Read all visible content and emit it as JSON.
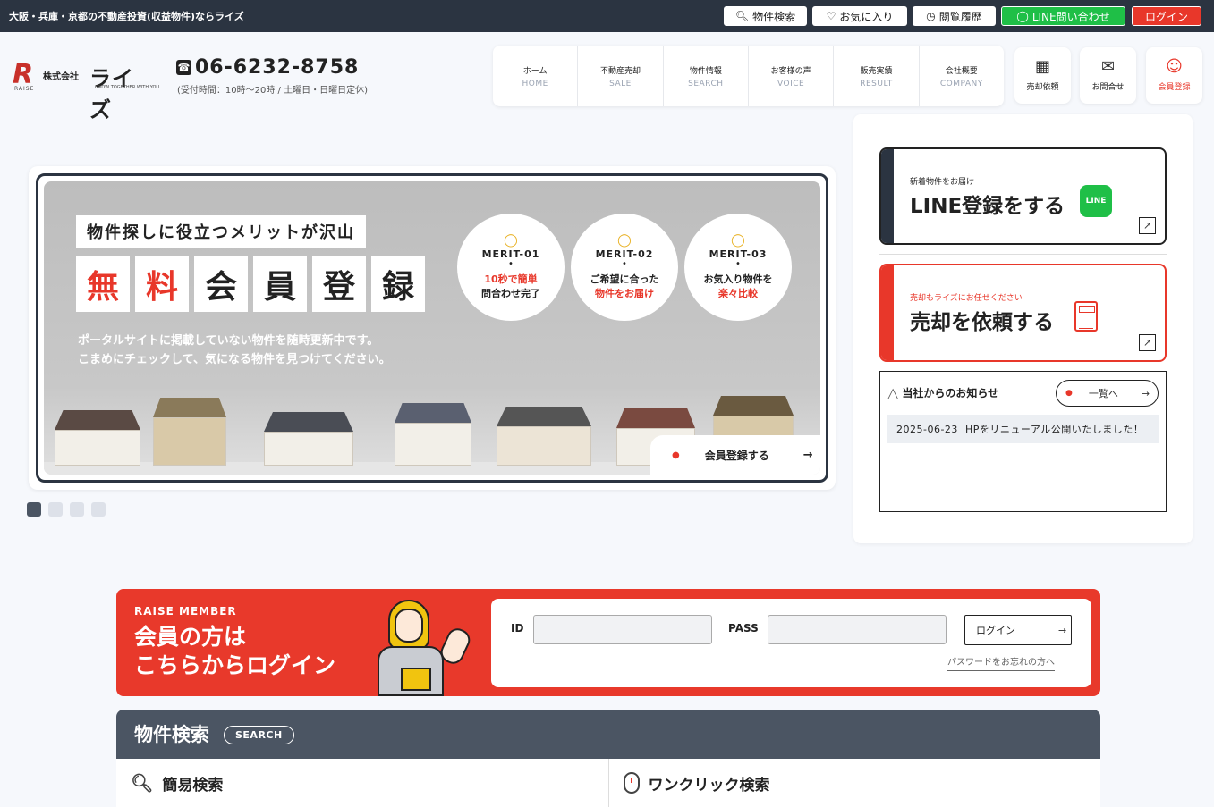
{
  "topbar": {
    "tagline": "大阪・兵庫・京都の不動産投資(収益物件)ならライズ",
    "buttons": [
      {
        "label": "物件検索",
        "icon": "search-icon"
      },
      {
        "label": "お気に入り",
        "icon": "heart-icon"
      },
      {
        "label": "閲覧履歴",
        "icon": "clock-icon"
      },
      {
        "label": "LINE問い合わせ",
        "icon": "chat-icon"
      },
      {
        "label": "ログイン"
      }
    ]
  },
  "header": {
    "logo": {
      "corp": "株式会社",
      "name": "ライズ",
      "sub": "RAISE",
      "slogan": "GROW TOGETHER WITH YOU"
    },
    "phone": "06-6232-8758",
    "hours": "(受付時間：10時〜20時 / 土曜日・日曜日定休)"
  },
  "nav": [
    {
      "jp": "ホーム",
      "en": "HOME"
    },
    {
      "jp": "不動産売却",
      "en": "SALE"
    },
    {
      "jp": "物件情報",
      "en": "SEARCH"
    },
    {
      "jp": "お客様の声",
      "en": "VOICE"
    },
    {
      "jp": "販売実績",
      "en": "RESULT"
    },
    {
      "jp": "会社概要",
      "en": "COMPANY"
    }
  ],
  "header_buttons": [
    {
      "label": "売却依頼",
      "icon": "calculator-icon"
    },
    {
      "label": "お問合せ",
      "icon": "mail-icon"
    },
    {
      "label": "会員登録",
      "icon": "user-icon"
    }
  ],
  "hero": {
    "title": "物件探しに役立つメリットが沢山",
    "big_chars": [
      "無",
      "料",
      "会",
      "員",
      "登",
      "録"
    ],
    "desc_lines": [
      "ポータルサイトに掲載していない物件を随時更新中です。",
      "こまめにチェックして、気になる物件を見つけてください。"
    ],
    "merits": [
      {
        "label": "MERIT-01",
        "line1": "10秒で簡単",
        "line2": "問合わせ完了"
      },
      {
        "label": "MERIT-02",
        "line1": "ご希望に合った",
        "line2": "物件をお届け"
      },
      {
        "label": "MERIT-03",
        "line1": "お気入り物件を",
        "line2": "楽々比較"
      }
    ],
    "cta": "会員登録する",
    "slide_count": 4,
    "active_slide": 1
  },
  "side": {
    "line_cta": {
      "small": "新着物件をお届け",
      "big": "LINE登録をする",
      "badge": "LINE"
    },
    "sell_cta": {
      "small": "売却もライズにお任せください",
      "big": "売却を依頼する"
    },
    "news": {
      "heading": "当社からのお知らせ",
      "all_button": "一覧へ",
      "items": [
        {
          "date": "2025-06-23",
          "text": "HPをリニューアル公開いたしました！"
        }
      ]
    }
  },
  "member": {
    "kicker": "RAISE MEMBER",
    "headline_lines": [
      "会員の方は",
      "こちらからログイン"
    ],
    "id_label": "ID",
    "pass_label": "PASS",
    "id_value": "",
    "pass_value": "",
    "login_button": "ログイン",
    "forgot": "パスワードをお忘れの方へ"
  },
  "search": {
    "title": "物件検索",
    "pill": "SEARCH",
    "simple": "簡易検索",
    "oneclick": "ワンクリック検索"
  },
  "colors": {
    "accent": "#e8372a",
    "dark": "#2b3441",
    "line_green": "#1fbf47"
  }
}
